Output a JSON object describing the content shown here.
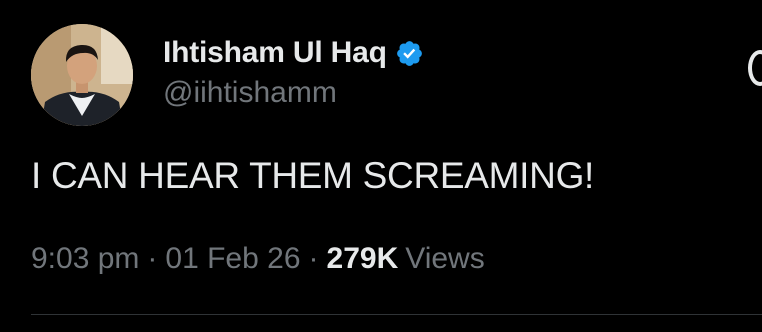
{
  "author": {
    "display_name": "Ihtisham Ul Haq",
    "handle": "@iihtishamm",
    "verified": true,
    "verified_color": "#1d9bf0"
  },
  "tweet": {
    "text": "I CAN HEAR THEM SCREAMING!",
    "time": "9:03 pm",
    "date": "01 Feb 26",
    "separator": "·",
    "views_count": "279K",
    "views_label": "Views"
  },
  "colors": {
    "background": "#000000",
    "primary_text": "#e7e9ea",
    "secondary_text": "#71767b",
    "divider": "#2f3336"
  }
}
